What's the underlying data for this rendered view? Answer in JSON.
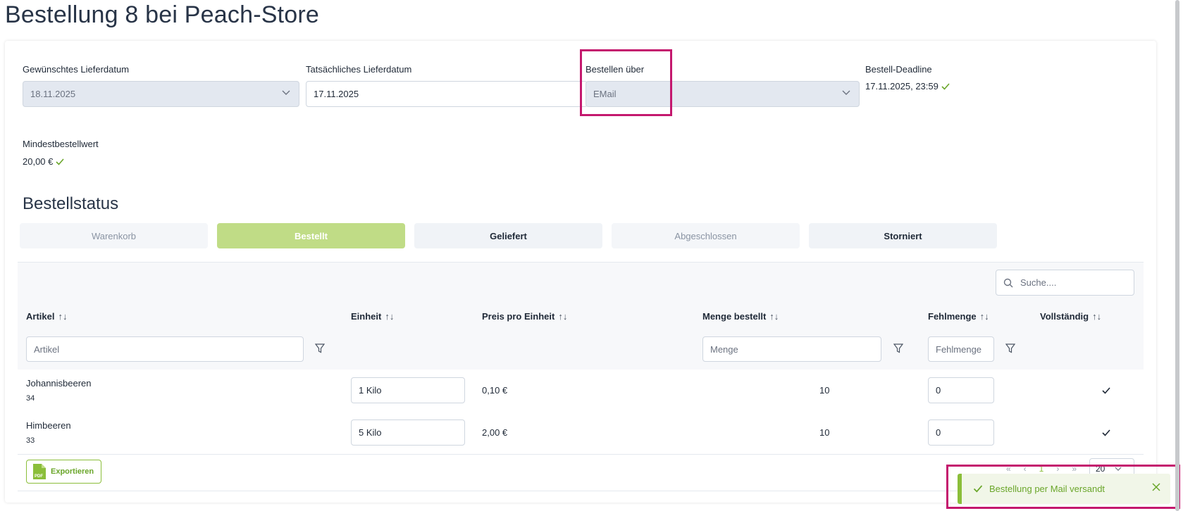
{
  "page": {
    "title": "Bestellung 8 bei Peach-Store"
  },
  "fields": {
    "desired_date": {
      "label": "Gewünschtes Lieferdatum",
      "value": "18.11.2025"
    },
    "actual_date": {
      "label": "Tatsächliches Lieferdatum",
      "value": "17.11.2025"
    },
    "order_via": {
      "label": "Bestellen über",
      "value": "EMail"
    },
    "deadline": {
      "label": "Bestell-Deadline",
      "value": "17.11.2025, 23:59"
    },
    "min_order": {
      "label": "Mindestbestellwert",
      "value": "20,00 €"
    }
  },
  "status": {
    "title": "Bestellstatus",
    "steps": [
      "Warenkorb",
      "Bestellt",
      "Geliefert",
      "Abgeschlossen",
      "Storniert"
    ],
    "active": "Bestellt"
  },
  "table": {
    "search_placeholder": "Suche....",
    "columns": [
      "Artikel",
      "Einheit",
      "Preis pro Einheit",
      "Menge bestellt",
      "Fehlmenge",
      "Vollständig"
    ],
    "filters": {
      "artikel": "Artikel",
      "menge": "Menge",
      "fehlmenge": "Fehlmenge"
    },
    "rows": [
      {
        "name": "Johannisbeeren",
        "id": "34",
        "unit": "1 Kilo",
        "price": "0,10 €",
        "qty": "10",
        "missing": "0",
        "complete": true
      },
      {
        "name": "Himbeeren",
        "id": "33",
        "unit": "5 Kilo",
        "price": "2,00 €",
        "qty": "10",
        "missing": "0",
        "complete": true
      }
    ],
    "export_label": "Exportieren",
    "pdf_label": "PDF",
    "pager": {
      "first": "«",
      "prev": "‹",
      "current": "1",
      "next": "›",
      "last": "»",
      "page_size": "20"
    }
  },
  "toast": {
    "message": "Bestellung per Mail versandt"
  },
  "colors": {
    "accent": "#8bbe3a",
    "highlight": "#c4186e",
    "active_step": "#c0dc86"
  }
}
